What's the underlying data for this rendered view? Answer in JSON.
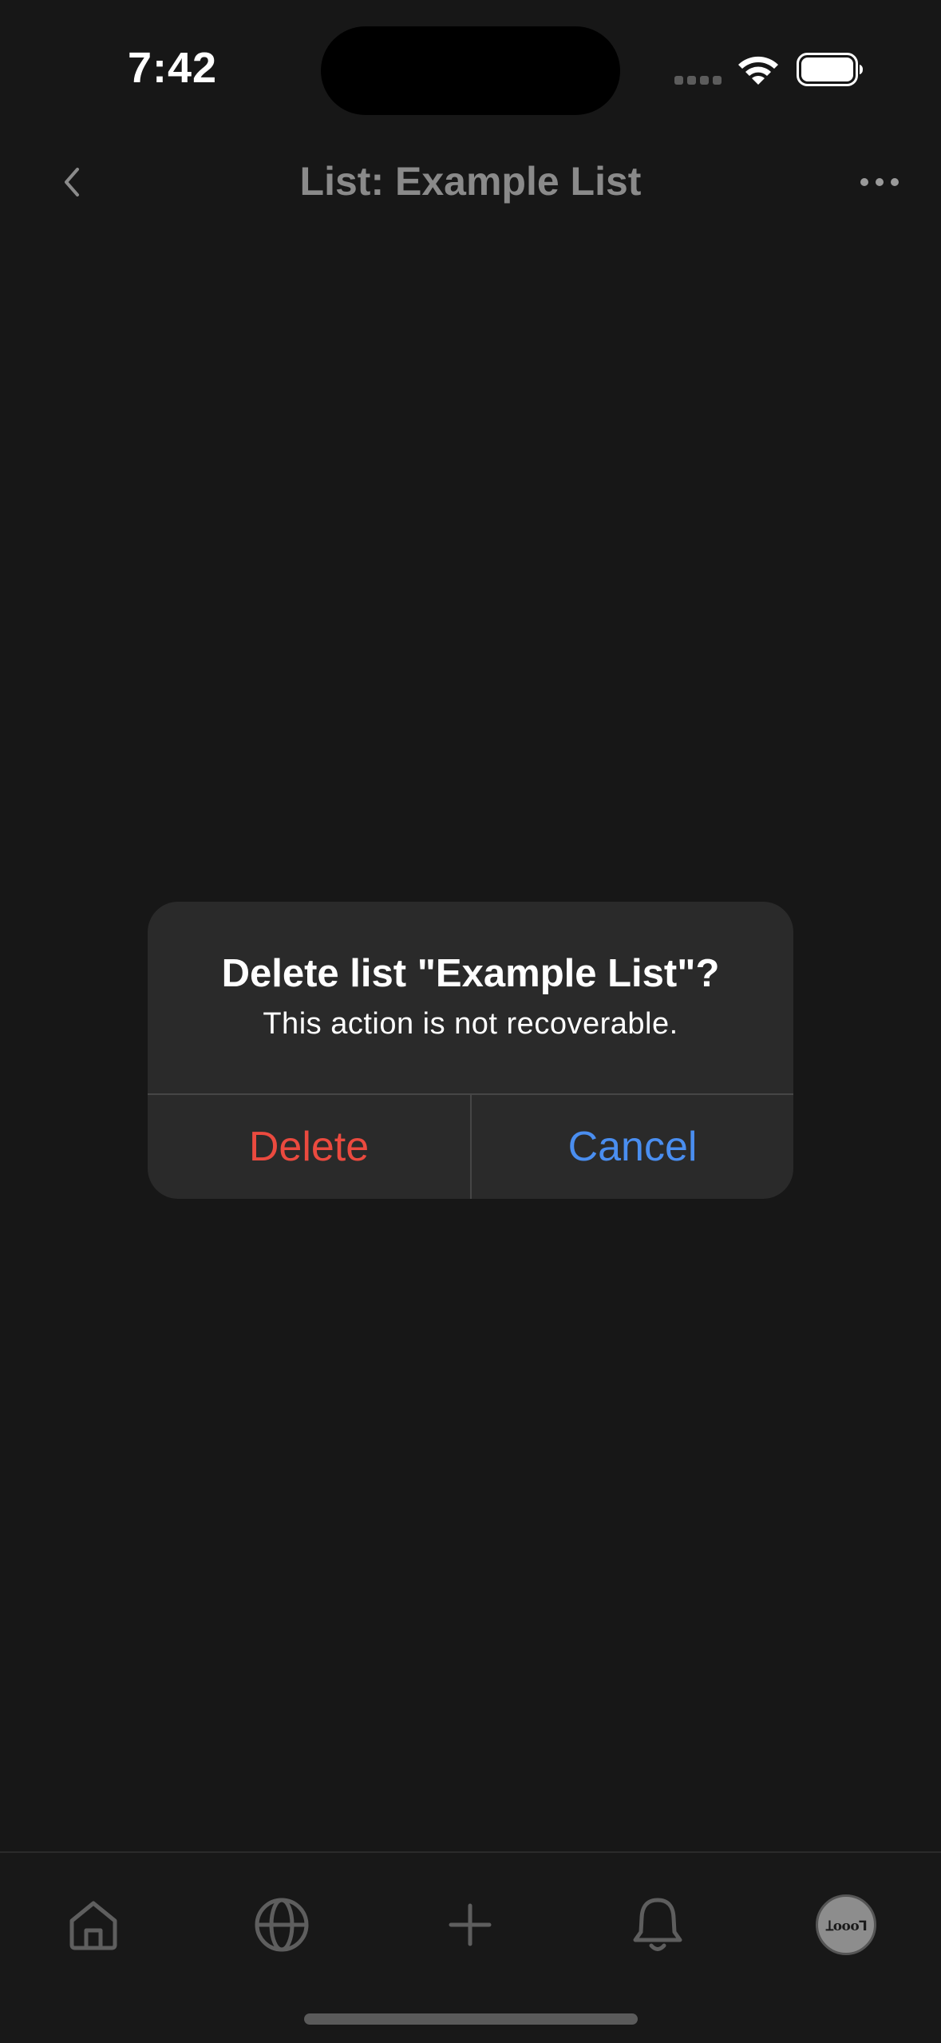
{
  "status_bar": {
    "time": "7:42"
  },
  "nav": {
    "title": "List: Example List",
    "back_icon": "chevron-left-icon",
    "more_icon": "ellipsis-icon"
  },
  "alert": {
    "title": "Delete list \"Example List\"?",
    "message": "This action is not recoverable.",
    "delete_label": "Delete",
    "cancel_label": "Cancel"
  },
  "tab_bar": {
    "items": [
      {
        "name": "home",
        "icon": "home-icon"
      },
      {
        "name": "explore",
        "icon": "globe-icon"
      },
      {
        "name": "compose",
        "icon": "plus-icon"
      },
      {
        "name": "notifications",
        "icon": "bell-icon"
      },
      {
        "name": "profile",
        "icon": "avatar"
      }
    ],
    "avatar_text": "Ʇooo⅂"
  },
  "colors": {
    "background": "#171717",
    "alert_background": "#2a2a2a",
    "destructive": "#eb4a3f",
    "accent": "#4a8ef0",
    "nav_title": "#8a8a8a"
  }
}
